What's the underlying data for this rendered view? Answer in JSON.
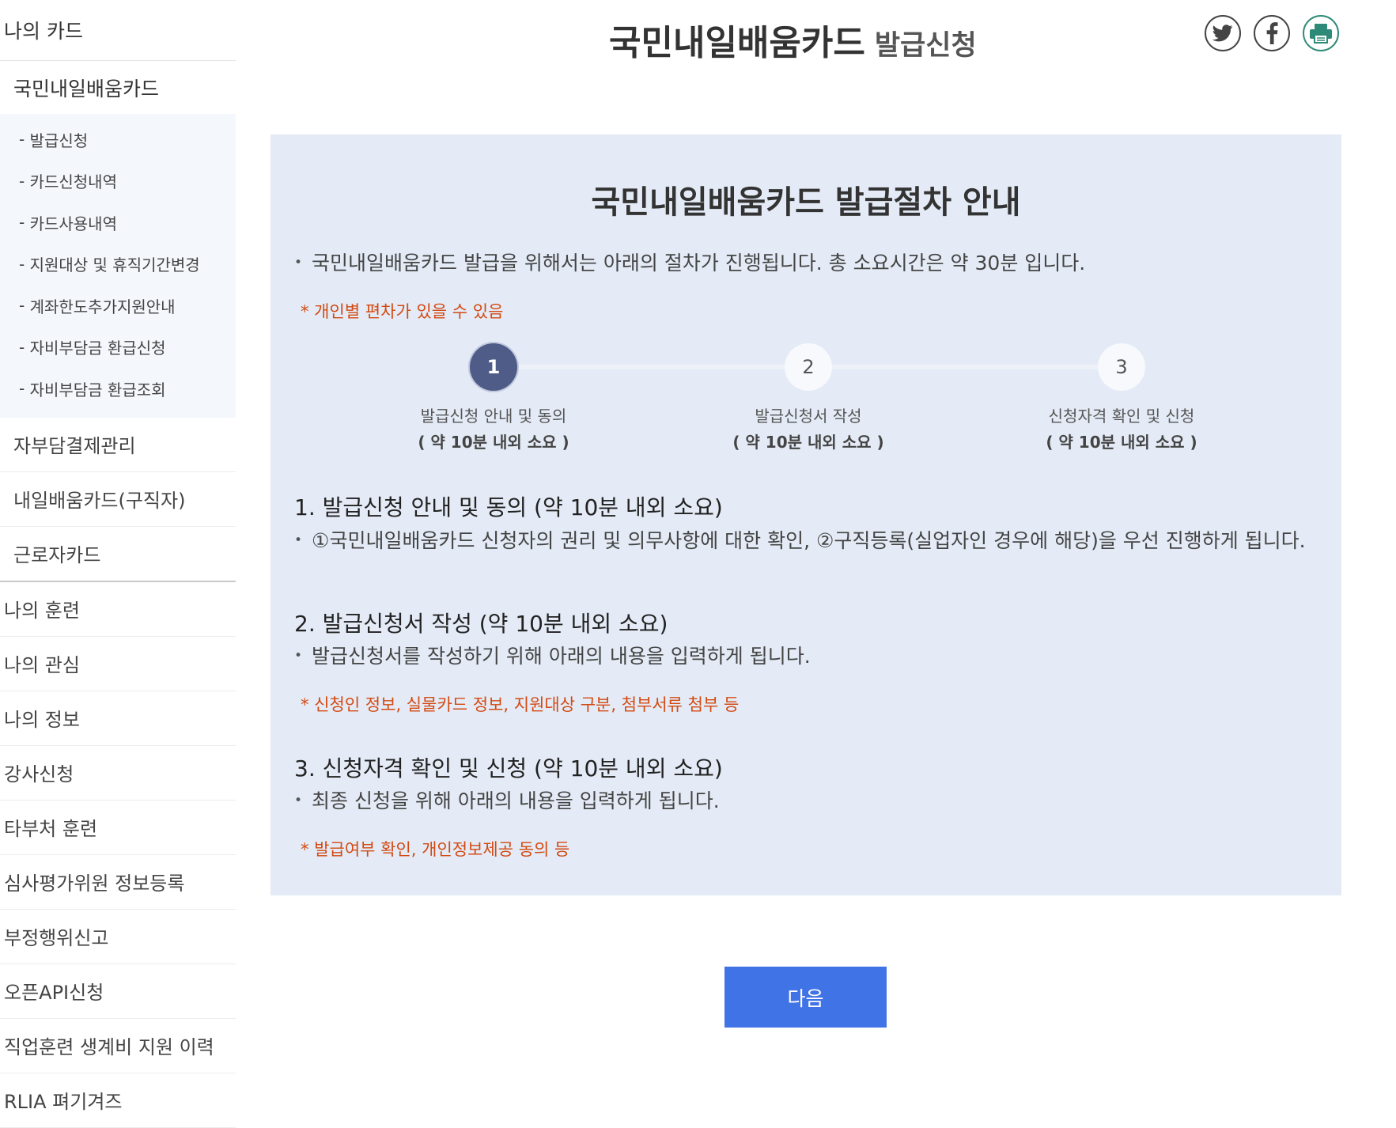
{
  "sidebar": {
    "top_title": "나의 카드",
    "card_section_title": "국민내일배움카드",
    "sub_items": [
      {
        "label": "발급신청"
      },
      {
        "label": "카드신청내역"
      },
      {
        "label": "카드사용내역"
      },
      {
        "label": "지원대상 및 휴직기간변경"
      },
      {
        "label": "계좌한도추가지원안내"
      },
      {
        "label": "자비부담금 환급신청"
      },
      {
        "label": "자비부담금 환급조회"
      }
    ],
    "second_items": [
      {
        "label": "자부담결제관리"
      },
      {
        "label": "내일배움카드(구직자)"
      },
      {
        "label": "근로자카드"
      }
    ],
    "main_items": [
      {
        "label": "나의 훈련"
      },
      {
        "label": "나의 관심"
      },
      {
        "label": "나의 정보"
      },
      {
        "label": "강사신청"
      },
      {
        "label": "타부처 훈련"
      },
      {
        "label": "심사평가위원 정보등록"
      },
      {
        "label": "부정행위신고"
      },
      {
        "label": "오픈API신청"
      },
      {
        "label": "직업훈련 생계비 지원 이력"
      },
      {
        "label": "RLIA 펴기겨즈"
      }
    ]
  },
  "header": {
    "title": "국민내일배움카드",
    "subtitle": "발급신청",
    "share_icons": [
      "twitter-icon",
      "facebook-icon",
      "print-icon"
    ]
  },
  "guide": {
    "title": "국민내일배움카드 발급절차 안내",
    "intro": "국민내일배움카드 발급을 위해서는 아래의 절차가 진행됩니다. 총 소요시간은 약 30분 입니다.",
    "intro_note": "* 개인별 편차가 있을 수 있음",
    "steps": [
      {
        "number": "1",
        "label": "발급신청 안내 및 동의",
        "time": "( 약 10분 내외 소요 )"
      },
      {
        "number": "2",
        "label": "발급신청서 작성",
        "time": "( 약 10분 내외 소요 )"
      },
      {
        "number": "3",
        "label": "신청자격 확인 및 신청",
        "time": "( 약 10분 내외 소요 )"
      }
    ],
    "current_step": 1,
    "sections": [
      {
        "title": "1. 발급신청 안내 및 동의 (약 10분 내외 소요)",
        "desc": "①국민내일배움카드 신청자의 권리 및 의무사항에 대한 확인, ②구직등록(실업자인 경우에 해당)을 우선 진행하게 됩니다.",
        "note": ""
      },
      {
        "title": "2. 발급신청서 작성 (약 10분 내외 소요)",
        "desc": "발급신청서를 작성하기 위해 아래의 내용을 입력하게 됩니다.",
        "note": "* 신청인 정보, 실물카드 정보, 지원대상 구분, 첨부서류 첨부 등"
      },
      {
        "title": "3. 신청자격 확인 및 신청 (약 10분 내외 소요)",
        "desc": "최종 신청을 위해 아래의 내용을 입력하게 됩니다.",
        "note": "* 발급여부 확인, 개인정보제공 동의 등"
      }
    ]
  },
  "next_button": {
    "label": "다음"
  },
  "colors": {
    "accent": "#4073e6",
    "panel_bg": "#e4ebf6",
    "note": "#d34a12",
    "active_step": "#4f5c88",
    "link": "#1f3c88"
  }
}
